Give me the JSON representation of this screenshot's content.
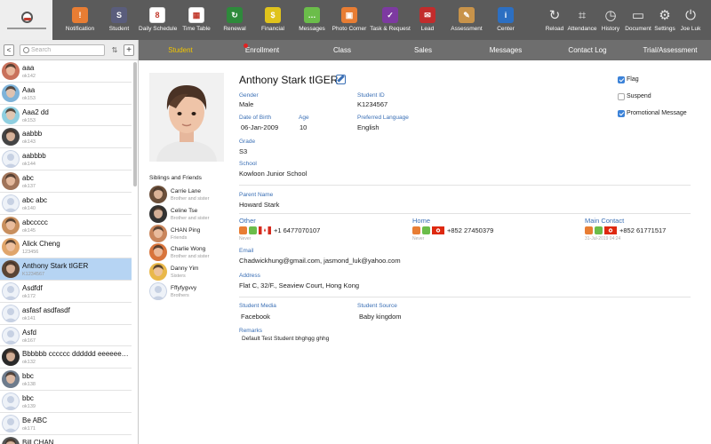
{
  "toolbar": {
    "left_items": [
      {
        "label": "Notification",
        "icon": "notification-icon",
        "color": "#e87d33",
        "glyph": "!"
      },
      {
        "label": "Student",
        "icon": "student-icon",
        "color": "#5a5d7c",
        "glyph": "S"
      },
      {
        "label": "Daily Schedule",
        "icon": "calendar-icon",
        "color": "#ffffff",
        "glyph": "8"
      },
      {
        "label": "Time Table",
        "icon": "timetable-icon",
        "color": "#ffffff",
        "glyph": "▦"
      },
      {
        "label": "Renewal",
        "icon": "renewal-icon",
        "color": "#2e8a3b",
        "glyph": "↻"
      },
      {
        "label": "Financial",
        "icon": "financial-icon",
        "color": "#e0c31c",
        "glyph": "$"
      },
      {
        "label": "Messages",
        "icon": "messages-icon",
        "color": "#6bbd4a",
        "glyph": "…"
      },
      {
        "label": "Photo Corner",
        "icon": "photo-icon",
        "color": "#e87d33",
        "glyph": "▣"
      },
      {
        "label": "Task & Request",
        "icon": "task-icon",
        "color": "#7d3aa1",
        "glyph": "✓"
      },
      {
        "label": "Lead",
        "icon": "lead-icon",
        "color": "#c22c2c",
        "glyph": "✉"
      },
      {
        "label": "Assessment",
        "icon": "assessment-icon",
        "color": "#c8934a",
        "glyph": "✎"
      },
      {
        "label": "Center",
        "icon": "center-icon",
        "color": "#2c6fc2",
        "glyph": "i"
      }
    ],
    "right_items": [
      {
        "label": "Reload",
        "icon": "reload-icon",
        "glyph": "↻"
      },
      {
        "label": "Attendance",
        "icon": "attendance-icon",
        "glyph": "⌗"
      },
      {
        "label": "History",
        "icon": "history-icon",
        "glyph": "◷"
      },
      {
        "label": "Document",
        "icon": "folder-icon",
        "glyph": "▭"
      },
      {
        "label": "Settings",
        "icon": "gear-icon",
        "glyph": "⚙"
      },
      {
        "label": "Joe Luk",
        "icon": "power-icon",
        "glyph": "⏻"
      }
    ]
  },
  "subnav": {
    "tabs": [
      "Student",
      "Enrollment",
      "Class",
      "Sales",
      "Messages",
      "Contact Log",
      "Trial/Assessment"
    ],
    "active": "Student"
  },
  "sidebar": {
    "search_placeholder": "Search",
    "back_glyph": "<",
    "sort_glyph": "⇅",
    "add_glyph": "+",
    "students": [
      {
        "name": "aaa",
        "code": "ok142",
        "avatar": "#c9725c"
      },
      {
        "name": "Aaa",
        "code": "ok153",
        "avatar": "#7eb3d9"
      },
      {
        "name": "Aaa2 dd",
        "code": "ok153",
        "avatar": "#8fcfe0"
      },
      {
        "name": "aabbb",
        "code": "ok143",
        "avatar": "#444444"
      },
      {
        "name": "aabbbb",
        "code": "ok144",
        "avatar": "#dfe6ef"
      },
      {
        "name": "abc",
        "code": "ok137",
        "avatar": "#a0745a"
      },
      {
        "name": "abc abc",
        "code": "ok140",
        "avatar": "#ffffff"
      },
      {
        "name": "abccccc",
        "code": "ok145",
        "avatar": "#c88f5e"
      },
      {
        "name": "Alick Cheng",
        "code": "123456",
        "avatar": "#e0a56b"
      },
      {
        "name": "Anthony Stark tIGER",
        "code": "K1234567",
        "avatar": "#5a4535"
      },
      {
        "name": "Asdfdf",
        "code": "ok172",
        "avatar": "#d6dff0"
      },
      {
        "name": "asfasf asdfasdf",
        "code": "ok141",
        "avatar": "#d6dff0"
      },
      {
        "name": "Asfd",
        "code": "ok167",
        "avatar": "#d6dff0"
      },
      {
        "name": "Bbbbbb cccccc dddddd eeeeeeee",
        "code": "ok132",
        "avatar": "#2a2a2a"
      },
      {
        "name": "bbc",
        "code": "ok138",
        "avatar": "#6d7b8c"
      },
      {
        "name": "bbc",
        "code": "ok139",
        "avatar": "#ffffff"
      },
      {
        "name": "Be ABC",
        "code": "ok171",
        "avatar": "#d6dff0"
      },
      {
        "name": "Bill CHAN",
        "code": "",
        "avatar": "#555555"
      }
    ],
    "selected_index": 9
  },
  "profile": {
    "name": "Anthony Stark tIGER",
    "fields": {
      "gender_label": "Gender",
      "gender": "Male",
      "student_id_label": "Student ID",
      "student_id": "K1234567",
      "dob_label": "Date of Birth",
      "dob": "06-Jan-2009",
      "age_label": "Age",
      "age": "10",
      "lang_label": "Preferred Language",
      "lang": "English",
      "grade_label": "Grade",
      "grade": "S3",
      "school_label": "School",
      "school": "Kowloon Junior School",
      "parent_label": "Parent Name",
      "parent": "Howard Stark",
      "email_label": "Email",
      "email": "Chadwickhung@gmail.com, jasmond_luk@yahoo.com",
      "address_label": "Address",
      "address": "Flat C, 32/F., Seaview Court, Hong Kong",
      "media_label": "Student Media",
      "media": "Facebook",
      "source_label": "Student Source",
      "source": "Baby kingdom",
      "remarks_label": "Remarks",
      "remarks": "Default Test Student bhghgg ghhg"
    },
    "checkboxes": [
      {
        "label": "Flag",
        "checked": true
      },
      {
        "label": "Suspend",
        "checked": false
      },
      {
        "label": "Promotional Message",
        "checked": true
      }
    ],
    "phones": [
      {
        "label": "Other",
        "number": "+1 6477070107",
        "sub": "Never",
        "flag": "canada-flag-icon"
      },
      {
        "label": "Home",
        "number": "+852 27450379",
        "sub": "Never",
        "flag": "hongkong-flag-icon"
      },
      {
        "label": "Main Contact",
        "number": "+852 61771517",
        "sub": "31-Jul-2019 04:24",
        "flag": "hongkong-flag-icon"
      }
    ],
    "siblings_title": "Siblings and Friends",
    "siblings": [
      {
        "name": "Carrie Lane",
        "relation": "Brother and sister",
        "avatar": "#6b4f3a"
      },
      {
        "name": "Celine Tse",
        "relation": "Brother and sister",
        "avatar": "#333333"
      },
      {
        "name": "CHAN Ping",
        "relation": "Friends",
        "avatar": "#c9855b"
      },
      {
        "name": "Charlie Wong",
        "relation": "Brother and sister",
        "avatar": "#d8743c"
      },
      {
        "name": "Danny Yim",
        "relation": "Sisters",
        "avatar": "#e9b84a"
      },
      {
        "name": "Fffyfygvvy",
        "relation": "Brothers",
        "avatar": "#d6dff0"
      }
    ]
  },
  "colors": {
    "toolbar_bg": "#5b5b5b",
    "subnav_bg": "#6e6e6e",
    "active_tab": "#f0c400",
    "label_blue": "#3a6fb5",
    "selected_row": "#b6d4f3"
  }
}
